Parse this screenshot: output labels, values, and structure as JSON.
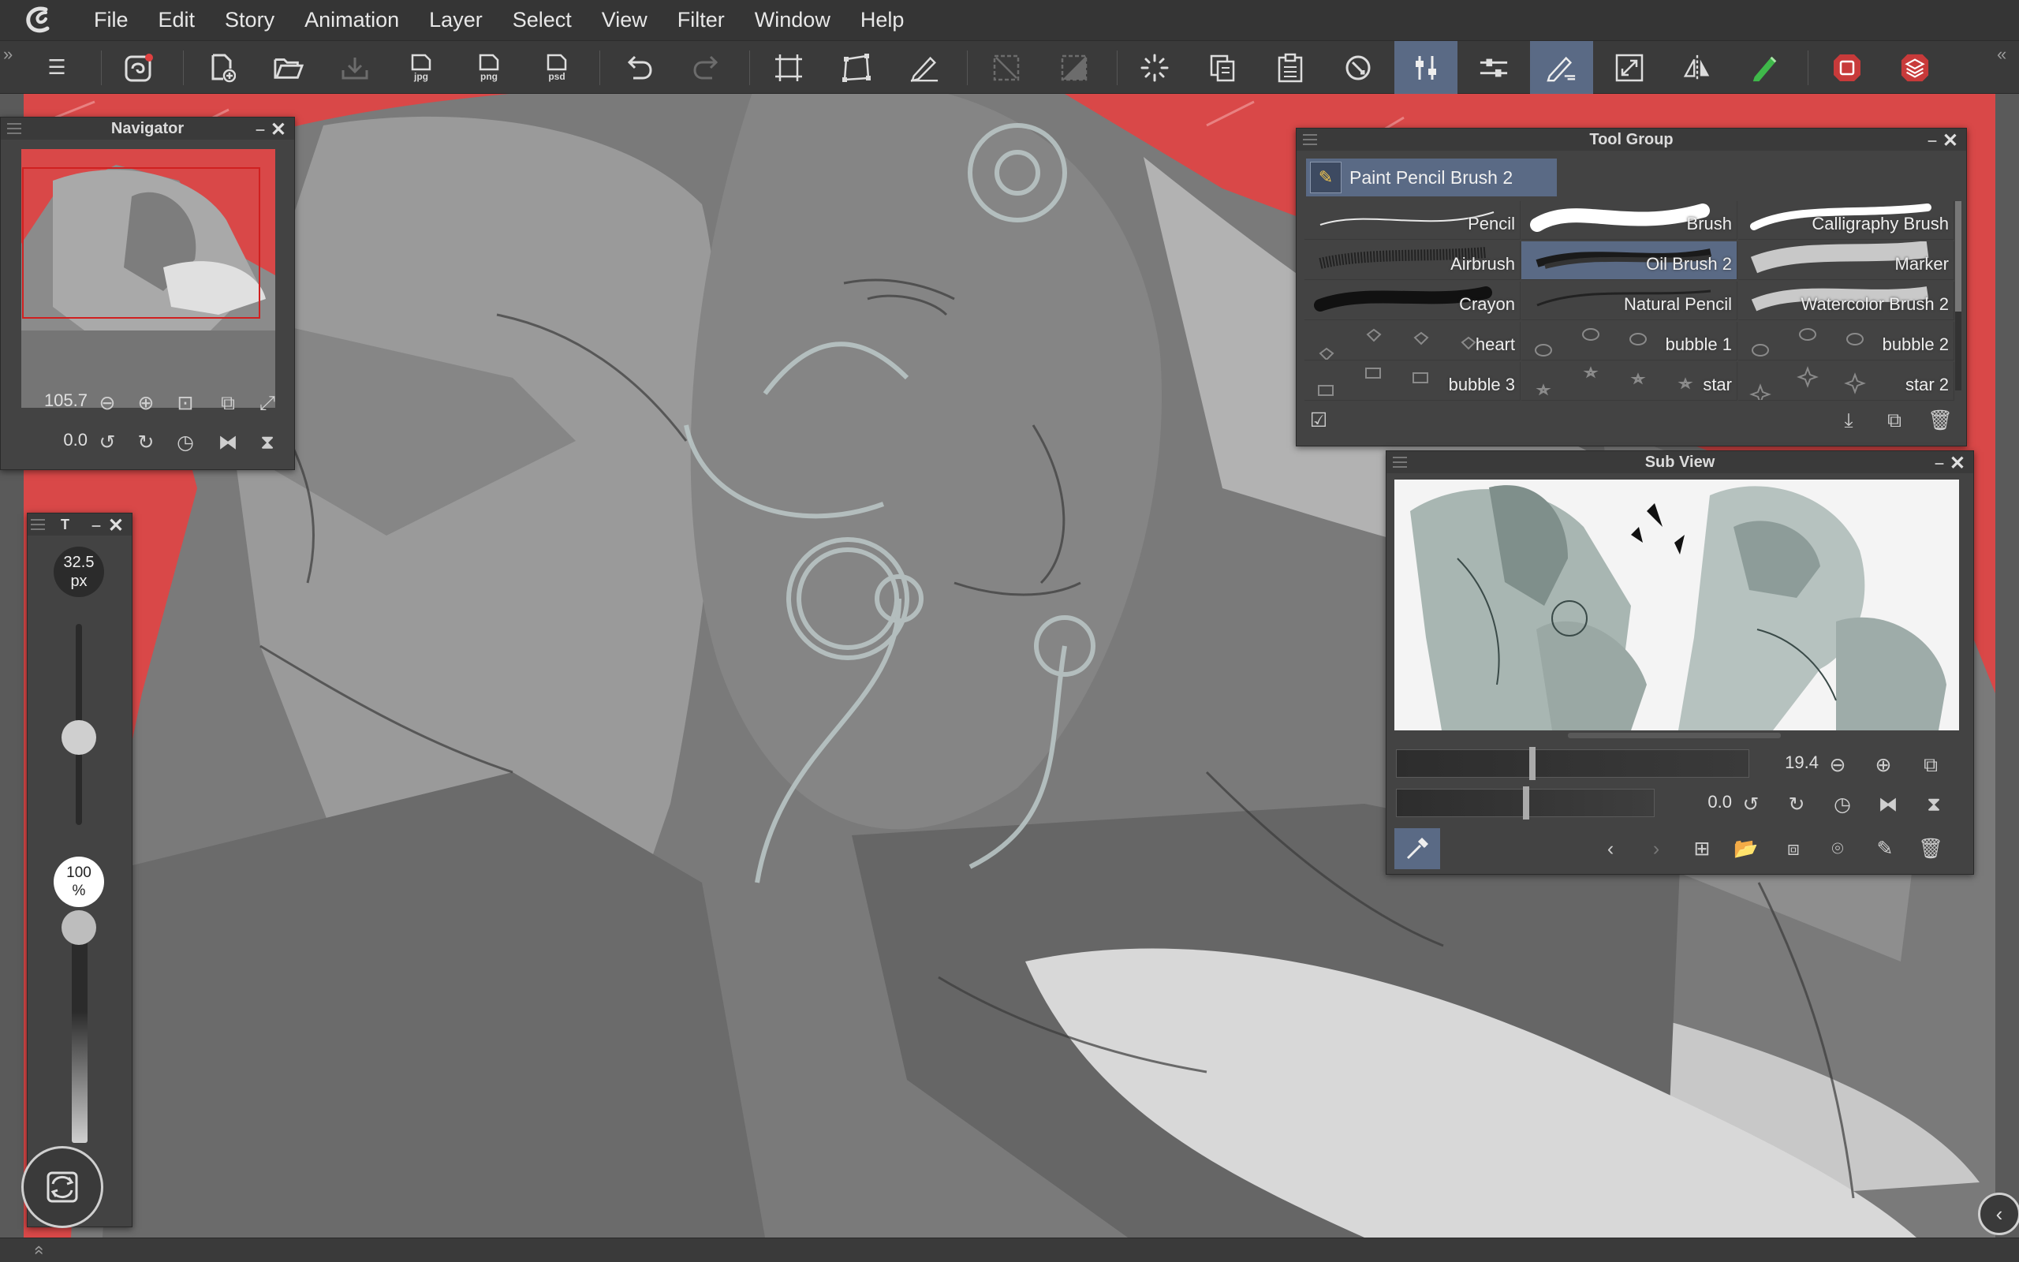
{
  "menu": [
    "File",
    "Edit",
    "Story",
    "Animation",
    "Layer",
    "Select",
    "View",
    "Filter",
    "Window",
    "Help"
  ],
  "command_bar": {
    "icons": [
      "menu-icon",
      "companion-icon",
      "new-file-icon",
      "open-file-icon",
      "save-icon",
      "export-jpg-icon",
      "export-png-icon",
      "export-psd-icon",
      "undo-icon",
      "redo-icon",
      "transform-icon",
      "free-transform-icon",
      "pen-ruler-icon",
      "clear-selection-icon",
      "invert-selection-icon",
      "loading-icon",
      "copy-icon",
      "paste-icon",
      "rotate-reset-icon",
      "tool-property-icon",
      "sub-tool-detail-icon",
      "sub-tool-icon",
      "fit-icon",
      "flip-icon",
      "color-icon",
      "record-icon",
      "layers-icon"
    ],
    "format_tags": {
      "jpg": "jpg",
      "png": "png",
      "psd": "psd"
    },
    "accent_color": "#5a6a85"
  },
  "navigator": {
    "title": "Navigator",
    "zoom": "105.7",
    "rotation": "0.0"
  },
  "brush_size_palette": {
    "title": "T",
    "size_value": "32.5",
    "size_unit": "px",
    "opacity_value": "100",
    "opacity_unit": "%",
    "size_level": 0.42,
    "opacity_level": 1.0
  },
  "tool_group": {
    "title": "Tool Group",
    "current_brush": "Paint Pencil Brush 2",
    "brushes": [
      {
        "name": "Pencil",
        "selected": false
      },
      {
        "name": "Brush",
        "selected": false
      },
      {
        "name": "Calligraphy Brush",
        "selected": false
      },
      {
        "name": "Airbrush",
        "selected": false
      },
      {
        "name": "Oil Brush 2",
        "selected": true
      },
      {
        "name": "Marker",
        "selected": false
      },
      {
        "name": "Crayon",
        "selected": false
      },
      {
        "name": "Natural Pencil",
        "selected": false
      },
      {
        "name": "Watercolor Brush 2",
        "selected": false
      },
      {
        "name": "heart",
        "selected": false
      },
      {
        "name": "bubble 1",
        "selected": false
      },
      {
        "name": "bubble 2",
        "selected": false
      },
      {
        "name": "bubble 3",
        "selected": false
      },
      {
        "name": "star",
        "selected": false
      },
      {
        "name": "star 2",
        "selected": false
      }
    ]
  },
  "sub_view": {
    "title": "Sub View",
    "zoom": "19.4",
    "rotation": "0.0"
  },
  "colors": {
    "canvas_red": "#d94848",
    "canvas_gray": "#7a7a7a",
    "panel_bg": "#434343",
    "selection": "#5a6a85"
  }
}
